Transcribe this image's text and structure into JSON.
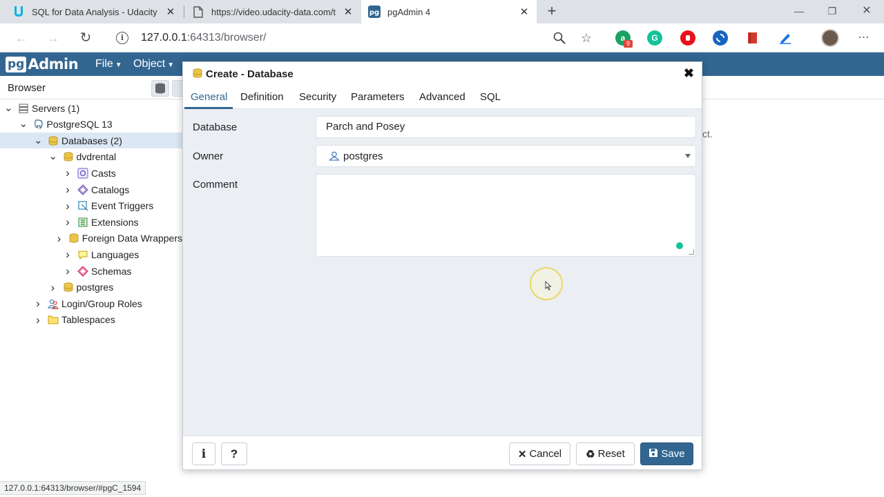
{
  "browser": {
    "tabs": [
      {
        "title": "SQL for Data Analysis - Udacity",
        "favicon": "udacity-icon"
      },
      {
        "title": "https://video.udacity-data.com/t",
        "favicon": "page-icon"
      },
      {
        "title": "pgAdmin 4",
        "favicon": "pgadmin-icon"
      }
    ],
    "url_host": "127.0.0.1",
    "url_port_path": ":64313/browser/",
    "extensions": [
      {
        "name": "grammarly-extension-icon",
        "color": "#1aa260",
        "label": "a",
        "badge": "9"
      },
      {
        "name": "grammarly-g-icon",
        "color": "#15c39a",
        "label": "G"
      },
      {
        "name": "adblock-icon",
        "color": "#e8121b",
        "label": ""
      },
      {
        "name": "sync-icon",
        "color": "#1565c0",
        "label": ""
      },
      {
        "name": "bookmark-red-icon",
        "color": "#d33b2c",
        "label": ""
      },
      {
        "name": "pen-icon",
        "color": "#1a73e8",
        "label": ""
      }
    ],
    "status_url": "127.0.0.1:64313/browser/#pgC_1594"
  },
  "pgadmin": {
    "menu": [
      {
        "label": "File"
      },
      {
        "label": "Object"
      }
    ],
    "browser_panel_title": "Browser",
    "tree": [
      {
        "label": "Servers (1)",
        "level": 0,
        "expanded": true,
        "icon": "servers-icon"
      },
      {
        "label": "PostgreSQL 13",
        "level": 1,
        "expanded": true,
        "icon": "postgres-elephant-icon"
      },
      {
        "label": "Databases (2)",
        "level": 2,
        "expanded": true,
        "icon": "databases-icon",
        "selected": true
      },
      {
        "label": "dvdrental",
        "level": 3,
        "expanded": true,
        "icon": "database-icon"
      },
      {
        "label": "Casts",
        "level": 4,
        "expanded": false,
        "icon": "casts-icon"
      },
      {
        "label": "Catalogs",
        "level": 4,
        "expanded": false,
        "icon": "catalogs-icon"
      },
      {
        "label": "Event Triggers",
        "level": 4,
        "expanded": false,
        "icon": "event-triggers-icon"
      },
      {
        "label": "Extensions",
        "level": 4,
        "expanded": false,
        "icon": "extensions-icon"
      },
      {
        "label": "Foreign Data Wrappers",
        "level": 4,
        "expanded": false,
        "icon": "foreign-data-wrappers-icon"
      },
      {
        "label": "Languages",
        "level": 4,
        "expanded": false,
        "icon": "languages-icon"
      },
      {
        "label": "Schemas",
        "level": 4,
        "expanded": false,
        "icon": "schemas-icon"
      },
      {
        "label": "postgres",
        "level": 3,
        "expanded": false,
        "icon": "database-icon"
      },
      {
        "label": "Login/Group Roles",
        "level": 2,
        "expanded": false,
        "icon": "roles-icon"
      },
      {
        "label": "Tablespaces",
        "level": 2,
        "expanded": false,
        "icon": "tablespaces-icon"
      }
    ],
    "right_panel_text": "ct."
  },
  "dialog": {
    "title": "Create - Database",
    "tabs": [
      {
        "label": "General",
        "active": true
      },
      {
        "label": "Definition"
      },
      {
        "label": "Security"
      },
      {
        "label": "Parameters"
      },
      {
        "label": "Advanced"
      },
      {
        "label": "SQL"
      }
    ],
    "fields": {
      "database_label": "Database",
      "database_value": "Parch and Posey",
      "owner_label": "Owner",
      "owner_value": "postgres",
      "comment_label": "Comment",
      "comment_value": ""
    },
    "buttons": {
      "info": "i",
      "help": "?",
      "cancel": "Cancel",
      "reset": "Reset",
      "save": "Save"
    }
  }
}
